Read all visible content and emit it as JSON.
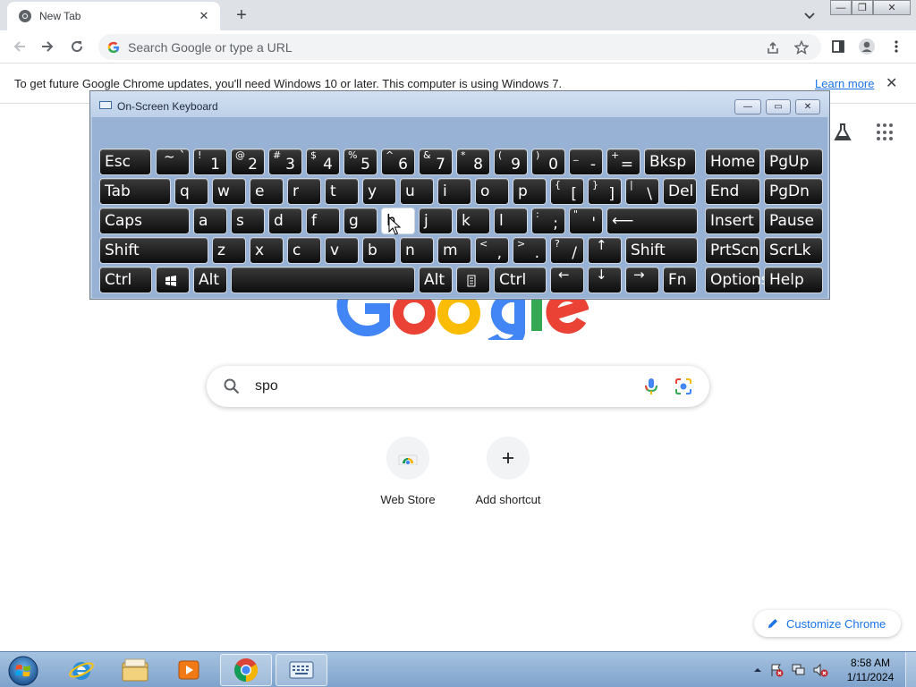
{
  "browser": {
    "tab": {
      "title": "New Tab",
      "close_glyph": "✕"
    },
    "new_tab_glyph": "+",
    "tab_search_glyph": "⌄",
    "window_controls": [
      "—",
      "❐",
      "✕"
    ],
    "omnibox": {
      "placeholder": "Search Google or type a URL"
    },
    "infobar": {
      "message": "To get future Google Chrome updates, you'll need Windows 10 or later. This computer is using Windows 7.",
      "link": "Learn more",
      "close_glyph": "✕"
    }
  },
  "ntp": {
    "search_query": "spo",
    "shortcuts": [
      {
        "label": "Web Store",
        "icon": "web-store-icon"
      },
      {
        "label": "Add shortcut",
        "icon": "plus-icon"
      }
    ],
    "customize_label": "Customize Chrome",
    "logo_colors": [
      "#4285f4",
      "#ea4335",
      "#fbbc05",
      "#4285f4",
      "#34a853",
      "#ea4335"
    ]
  },
  "osk": {
    "title": "On-Screen Keyboard",
    "title_buttons": [
      "—",
      "▭",
      "✕"
    ],
    "highlighted_key": "h",
    "rows": [
      [
        {
          "main": "Esc"
        },
        {
          "sm": "~ `"
        },
        {
          "sm": "!",
          "big": "1"
        },
        {
          "sm": "@",
          "big": "2"
        },
        {
          "sm": "#",
          "big": "3"
        },
        {
          "sm": "$",
          "big": "4"
        },
        {
          "sm": "%",
          "big": "5"
        },
        {
          "sm": "^",
          "big": "6"
        },
        {
          "sm": "&",
          "big": "7"
        },
        {
          "sm": "*",
          "big": "8"
        },
        {
          "sm": "(",
          "big": "9"
        },
        {
          "sm": ")",
          "big": "0"
        },
        {
          "sm": "_",
          "big": "-"
        },
        {
          "sm": "+",
          "big": "="
        },
        {
          "main": "Bksp"
        },
        {
          "main": "Home"
        },
        {
          "main": "PgUp"
        }
      ],
      [
        {
          "main": "Tab"
        },
        {
          "main": "q"
        },
        {
          "main": "w"
        },
        {
          "main": "e"
        },
        {
          "main": "r"
        },
        {
          "main": "t"
        },
        {
          "main": "y"
        },
        {
          "main": "u"
        },
        {
          "main": "i"
        },
        {
          "main": "o"
        },
        {
          "main": "p"
        },
        {
          "sm": "{",
          "big": "["
        },
        {
          "sm": "}",
          "big": "]"
        },
        {
          "sm": "|",
          "big": "\\"
        },
        {
          "main": "Del"
        },
        {
          "main": "End"
        },
        {
          "main": "PgDn"
        }
      ],
      [
        {
          "main": "Caps"
        },
        {
          "main": "a"
        },
        {
          "main": "s"
        },
        {
          "main": "d"
        },
        {
          "main": "f"
        },
        {
          "main": "g"
        },
        {
          "main": "h"
        },
        {
          "main": "j"
        },
        {
          "main": "k"
        },
        {
          "main": "l"
        },
        {
          "sm": ":",
          "big": ";"
        },
        {
          "sm": "\"",
          "big": "'"
        },
        {
          "main": "⟵"
        },
        {
          "main": "Insert"
        },
        {
          "main": "Pause"
        }
      ],
      [
        {
          "main": "Shift"
        },
        {
          "main": "z"
        },
        {
          "main": "x"
        },
        {
          "main": "c"
        },
        {
          "main": "v"
        },
        {
          "main": "b"
        },
        {
          "main": "n"
        },
        {
          "main": "m"
        },
        {
          "sm": "<",
          "big": ","
        },
        {
          "sm": ">",
          "big": "."
        },
        {
          "sm": "?",
          "big": "/"
        },
        {
          "sm": "↑"
        },
        {
          "main": "Shift"
        },
        {
          "main": "PrtScn"
        },
        {
          "main": "ScrLk"
        }
      ],
      [
        {
          "main": "Ctrl"
        },
        {
          "icon": "windows-key-icon"
        },
        {
          "main": "Alt"
        },
        {
          "main": ""
        },
        {
          "main": "Alt"
        },
        {
          "icon": "menu-key-icon"
        },
        {
          "main": "Ctrl"
        },
        {
          "sm": "←"
        },
        {
          "sm": "↓"
        },
        {
          "sm": "→"
        },
        {
          "main": "Fn"
        },
        {
          "main": "Options"
        },
        {
          "main": "Help"
        }
      ]
    ]
  },
  "taskbar": {
    "items": [
      "internet-explorer-icon",
      "windows-explorer-icon",
      "media-player-icon",
      "chrome-icon",
      "on-screen-keyboard-icon"
    ],
    "active_items": [
      "chrome-icon",
      "on-screen-keyboard-icon"
    ],
    "clock": {
      "time": "8:58 AM",
      "date": "1/11/2024"
    }
  }
}
